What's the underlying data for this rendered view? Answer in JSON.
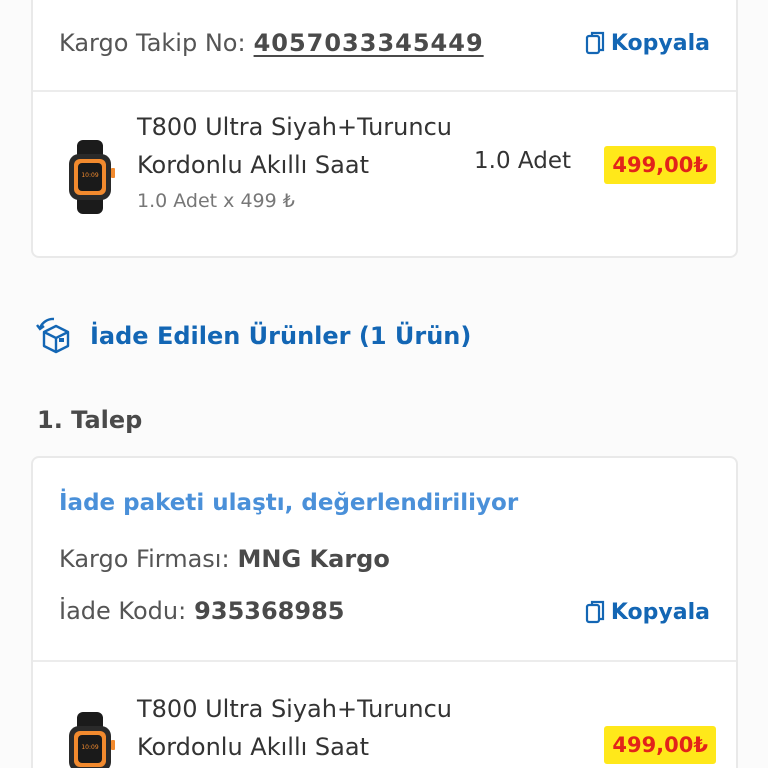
{
  "shipment": {
    "tracking_label": "Kargo Takip No:",
    "tracking_number": "4057033345449",
    "copy_label": "Kopyala"
  },
  "product1": {
    "name_line1": "T800 Ultra Siyah+Turuncu",
    "name_line2": "Kordonlu Akıllı Saat",
    "unit_info": "1.0 Adet x 499 ₺",
    "quantity": "1.0 Adet",
    "price": "499,00₺"
  },
  "returns": {
    "section_title": "İade Edilen Ürünler (1 Ürün)",
    "request_label": "1. Talep",
    "status": "İade paketi ulaştı, değerlendiriliyor",
    "carrier_label": "Kargo Firması:",
    "carrier_value": "MNG Kargo",
    "code_label": "İade Kodu:",
    "code_value": "935368985",
    "copy_label": "Kopyala"
  },
  "product2": {
    "name_line1": "T800 Ultra Siyah+Turuncu",
    "name_line2": "Kordonlu Akıllı Saat",
    "price": "499,00₺"
  },
  "colors": {
    "accent": "#1366b4",
    "status_blue": "#4a90d9",
    "price_bg": "#ffe81a",
    "price_text": "#e2231a"
  },
  "icons": {
    "copy": "copy-icon",
    "return_box": "return-box-icon",
    "product_image": "smartwatch-image"
  }
}
